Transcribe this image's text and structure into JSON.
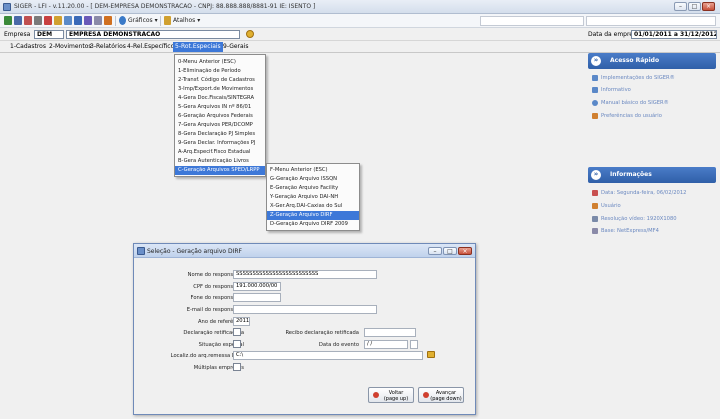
{
  "window": {
    "title": "SIGER - LFI - v.11.20.00 - [ DEM-EMPRESA DEMONSTRACAO - CNPJ: 88.888.888/8881-91 IE: ISENTO ]"
  },
  "toolbar": {
    "graficos_label": "Gráficos",
    "atalhos_label": "Atalhos"
  },
  "empresa": {
    "label": "Empresa",
    "code": "DEM",
    "name": "EMPRESA DEMONSTRACAO",
    "date_label": "Data da empresa",
    "date_range": "01/01/2011 a 31/12/2012"
  },
  "menubar": {
    "items": [
      "1-Cadastros",
      "2-Movimentos",
      "3-Relatórios",
      "4-Rel.Específicos",
      "5-Rot.Especiais",
      "9-Gerais"
    ]
  },
  "menu1": {
    "items": [
      "0-Menu Anterior (ESC)",
      "1-Eliminação de Período",
      "2-Transf. Código de Cadastros",
      "3-Imp/Export.de Movimentos",
      "4-Gera Doc.Fiscais/SINTEGRA",
      "5-Gera Arquivos IN nº 86/01",
      "6-Geração Arquivos Federais",
      "7-Gera Arquivos PER/DCOMP",
      "8-Gera Declaração PJ Simples",
      "9-Gera Declar. Informações PJ",
      "A-Arq.Especif.Fisco Estadual",
      "B-Gera Autenticação Livros",
      "C-Geração Arquivos SPED/LRPP"
    ]
  },
  "menu2": {
    "items": [
      "F-Menu Anterior (ESC)",
      "G-Geração Arquivo ISSQN",
      "E-Geração Arquivo Facility",
      "Y-Geração Arquivo DAI-NH",
      "X-Ger.Arq.DAI-Caxias do Sul",
      "Z-Geração Arquivo DIRF",
      "D-Geração Arquivo DIRF 2009"
    ]
  },
  "sidebar": {
    "quick_title": "Acesso Rápido",
    "quick_links": [
      "Implementações do SIGER®",
      "Informativo",
      "Manual básico do SIGER®",
      "Preferências do usuário"
    ],
    "info_title": "Informações",
    "info_items": [
      "Data: Segunda-feira, 06/02/2012",
      "Usuário",
      "Resolução vídeo: 1920X1080",
      "Base: NetExpress/MF4"
    ]
  },
  "dialog": {
    "title": "Seleção - Geração arquivo DIRF",
    "labels": {
      "nome": "Nome do responsável",
      "cpf": "CPF do responsável",
      "fone": "Fone do responsável",
      "email": "E-mail do responsável",
      "ano": "Ano de referência",
      "retificadora": "Declaração retificadora",
      "recibo": "Recibo declaração retificada",
      "situacao": "Situação especial",
      "data_evento": "Data do evento",
      "local": "Localiz.do arq.remessa DIRF",
      "multiplas": "Múltiplas empresas"
    },
    "values": {
      "nome": "SSSSSSSSSSSSSSSSSSSSSSSSS",
      "cpf": "191.000.000/00",
      "fone": "",
      "email": "",
      "ano": "2011",
      "recibo": "",
      "data_evento": "/ /",
      "local": "C:\\"
    },
    "btn_voltar": "Voltar",
    "btn_voltar_sub": "(page up)",
    "btn_avancar": "Avançar",
    "btn_avancar_sub": "(page down)"
  }
}
